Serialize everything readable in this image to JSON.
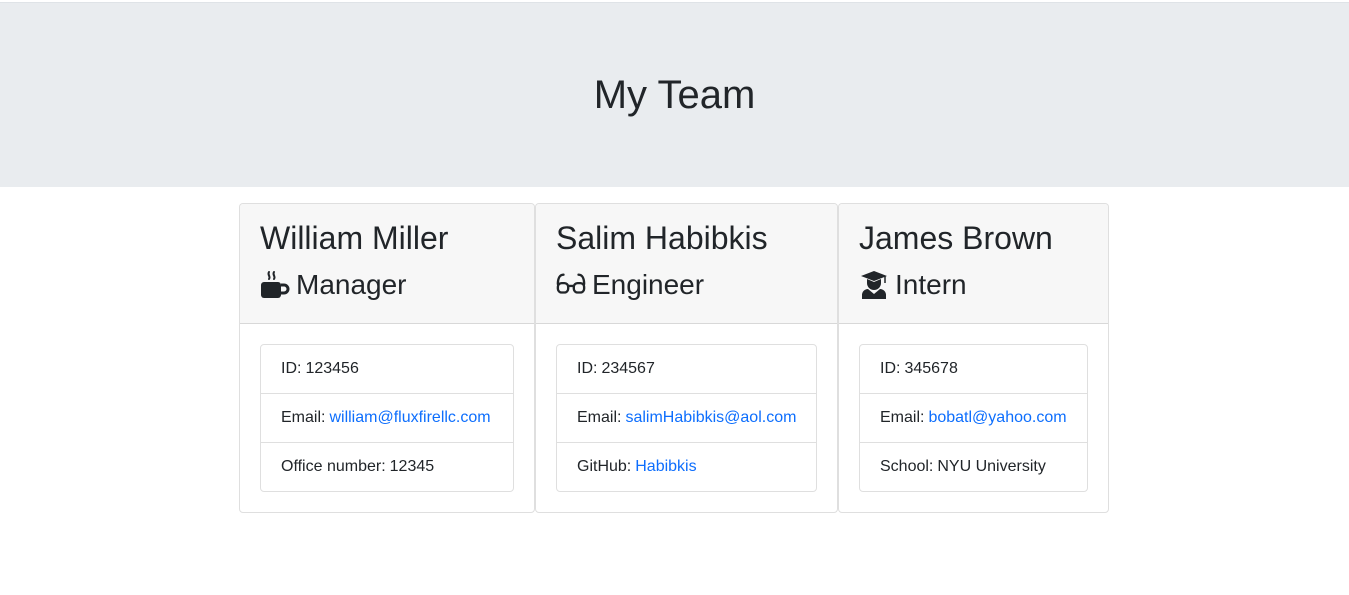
{
  "header": {
    "title": "My Team"
  },
  "cards": [
    {
      "name": "William Miller",
      "role": "Manager",
      "role_icon": "mug-icon",
      "id_label": "ID:",
      "id": "123456",
      "email_label": "Email:",
      "email": "william@fluxfirellc.com",
      "extra_label": "Office number:",
      "extra_value": "12345"
    },
    {
      "name": "Salim Habibkis",
      "role": "Engineer",
      "role_icon": "glasses-icon",
      "id_label": "ID:",
      "id": "234567",
      "email_label": "Email:",
      "email": "salimHabibkis@aol.com",
      "extra_label": "GitHub:",
      "extra_value": "Habibkis"
    },
    {
      "name": "James Brown",
      "role": "Intern",
      "role_icon": "graduate-icon",
      "id_label": "ID:",
      "id": "345678",
      "email_label": "Email:",
      "email": "bobatl@yahoo.com",
      "extra_label": "School:",
      "extra_value": "NYU University"
    }
  ],
  "colors": {
    "jumbotron_bg": "#e9ecef",
    "link": "#0d6efd",
    "text": "#212529",
    "card_header_bg": "#f7f7f7"
  }
}
